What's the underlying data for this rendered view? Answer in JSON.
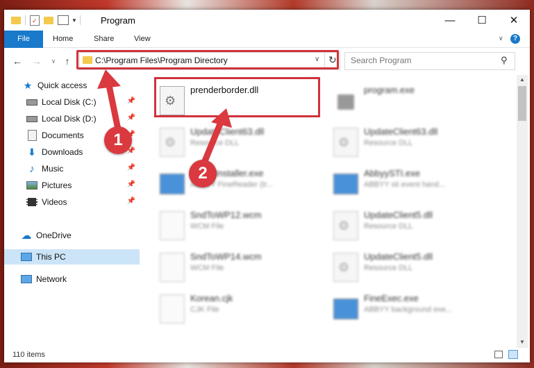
{
  "window": {
    "title": "Program",
    "minimize_glyph": "—",
    "maximize_glyph": "☐",
    "close_glyph": "✕"
  },
  "ribbon": {
    "tabs": [
      {
        "label": "File"
      },
      {
        "label": "Home"
      },
      {
        "label": "Share"
      },
      {
        "label": "View"
      }
    ],
    "help_glyph": "?"
  },
  "nav": {
    "address": "C:\\Program Files\\Program Directory",
    "search_placeholder": "Search Program"
  },
  "sidebar": {
    "items": [
      {
        "label": "Quick access",
        "icon": "star-icon"
      },
      {
        "label": "Local Disk (C:)",
        "icon": "drive-icon",
        "pinned": true
      },
      {
        "label": "Local Disk (D:)",
        "icon": "drive-icon",
        "pinned": true
      },
      {
        "label": "Documents",
        "icon": "documents-icon",
        "pinned": true
      },
      {
        "label": "Downloads",
        "icon": "download-icon",
        "pinned": true
      },
      {
        "label": "Music",
        "icon": "music-icon",
        "pinned": true
      },
      {
        "label": "Pictures",
        "icon": "pictures-icon",
        "pinned": true
      },
      {
        "label": "Videos",
        "icon": "videos-icon",
        "pinned": true
      },
      {
        "label": "OneDrive",
        "icon": "cloud-icon"
      },
      {
        "label": "This PC",
        "icon": "computer-icon",
        "selected": true
      },
      {
        "label": "Network",
        "icon": "network-icon"
      }
    ]
  },
  "files": [
    {
      "name": "prenderborder.dll",
      "type": "",
      "icon": "dll-gear-icon",
      "highlighted": true
    },
    {
      "name": "program.exe",
      "type": "",
      "icon": "exe-icon"
    },
    {
      "name": "UpdateClient63.dll",
      "type": "Resource DLL",
      "icon": "dll-gear-icon"
    },
    {
      "name": "UpdateClient63.dll",
      "type": "Resource DLL",
      "icon": "dll-gear-icon"
    },
    {
      "name": "AbbyyInstaller.exe",
      "type": "ABBYY FineReader (tr...",
      "icon": "exe-window-icon"
    },
    {
      "name": "AbbyySTI.exe",
      "type": "ABBYY sti event hand...",
      "icon": "exe-window-icon"
    },
    {
      "name": "SndToWP12.wcm",
      "type": "WCM File",
      "icon": "blank-file-icon"
    },
    {
      "name": "UpdateClient5.dll",
      "type": "Resource DLL",
      "icon": "dll-gear-icon"
    },
    {
      "name": "SndToWP14.wcm",
      "type": "WCM File",
      "icon": "blank-file-icon"
    },
    {
      "name": "UpdateClient5.dll",
      "type": "Resource DLL",
      "icon": "dll-gear-icon"
    },
    {
      "name": "Korean.cjk",
      "type": "CJK File",
      "icon": "blank-file-icon"
    },
    {
      "name": "FineExec.exe",
      "type": "ABBYY background exe...",
      "icon": "exe-window-icon"
    }
  ],
  "status": {
    "item_count": "110 items"
  },
  "annotations": {
    "badge_1": "1",
    "badge_2": "2"
  }
}
